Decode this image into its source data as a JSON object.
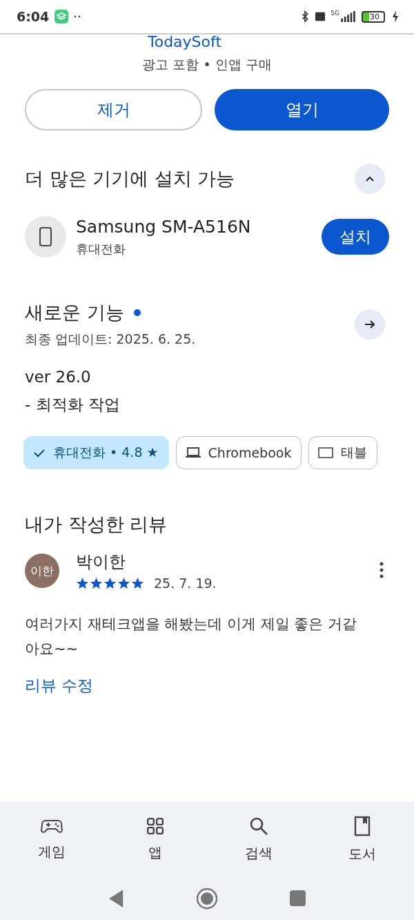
{
  "status_bar": {
    "time": "6:04",
    "network": "5G",
    "battery": "30"
  },
  "app": {
    "developer": "TodaySoft",
    "notes": "광고 포함 • 인앱 구매"
  },
  "actions": [
    {
      "label": "제거",
      "kind": "outline"
    },
    {
      "label": "열기",
      "kind": "filled"
    }
  ],
  "devices_section": {
    "title": "더 많은 기기에 설치 가능",
    "expanded": true,
    "device": {
      "name": "Samsung SM-A516N",
      "type": "휴대전화",
      "button": "설치"
    }
  },
  "whats_new": {
    "title": "새로운 기능",
    "updated": "최종 업데이트: 2025. 6. 25.",
    "lines": [
      "ver 26.0",
      "- 최적화 작업"
    ]
  },
  "device_chips": [
    {
      "label": "휴대전화 • 4.8 ★",
      "selected": true
    },
    {
      "label": "Chromebook",
      "kind": "laptop",
      "selected": false
    },
    {
      "label": "태블",
      "kind": "tablet",
      "selected": false
    }
  ],
  "my_review": {
    "title": "내가 작성한 리뷰",
    "avatar": "이한",
    "author": "박이한",
    "stars": 5,
    "date": "25. 7. 19.",
    "text": "여러가지 재테크앱을 해봤는데 이게 제일 좋은 거같아요~~",
    "edit": "리뷰 수정"
  },
  "bottom_nav": [
    {
      "label": "게임",
      "kind": "games",
      "selected": false
    },
    {
      "label": "앱",
      "kind": "apps",
      "selected": false
    },
    {
      "label": "검색",
      "kind": "search",
      "selected": false
    },
    {
      "label": "도서",
      "kind": "books",
      "selected": false
    }
  ]
}
